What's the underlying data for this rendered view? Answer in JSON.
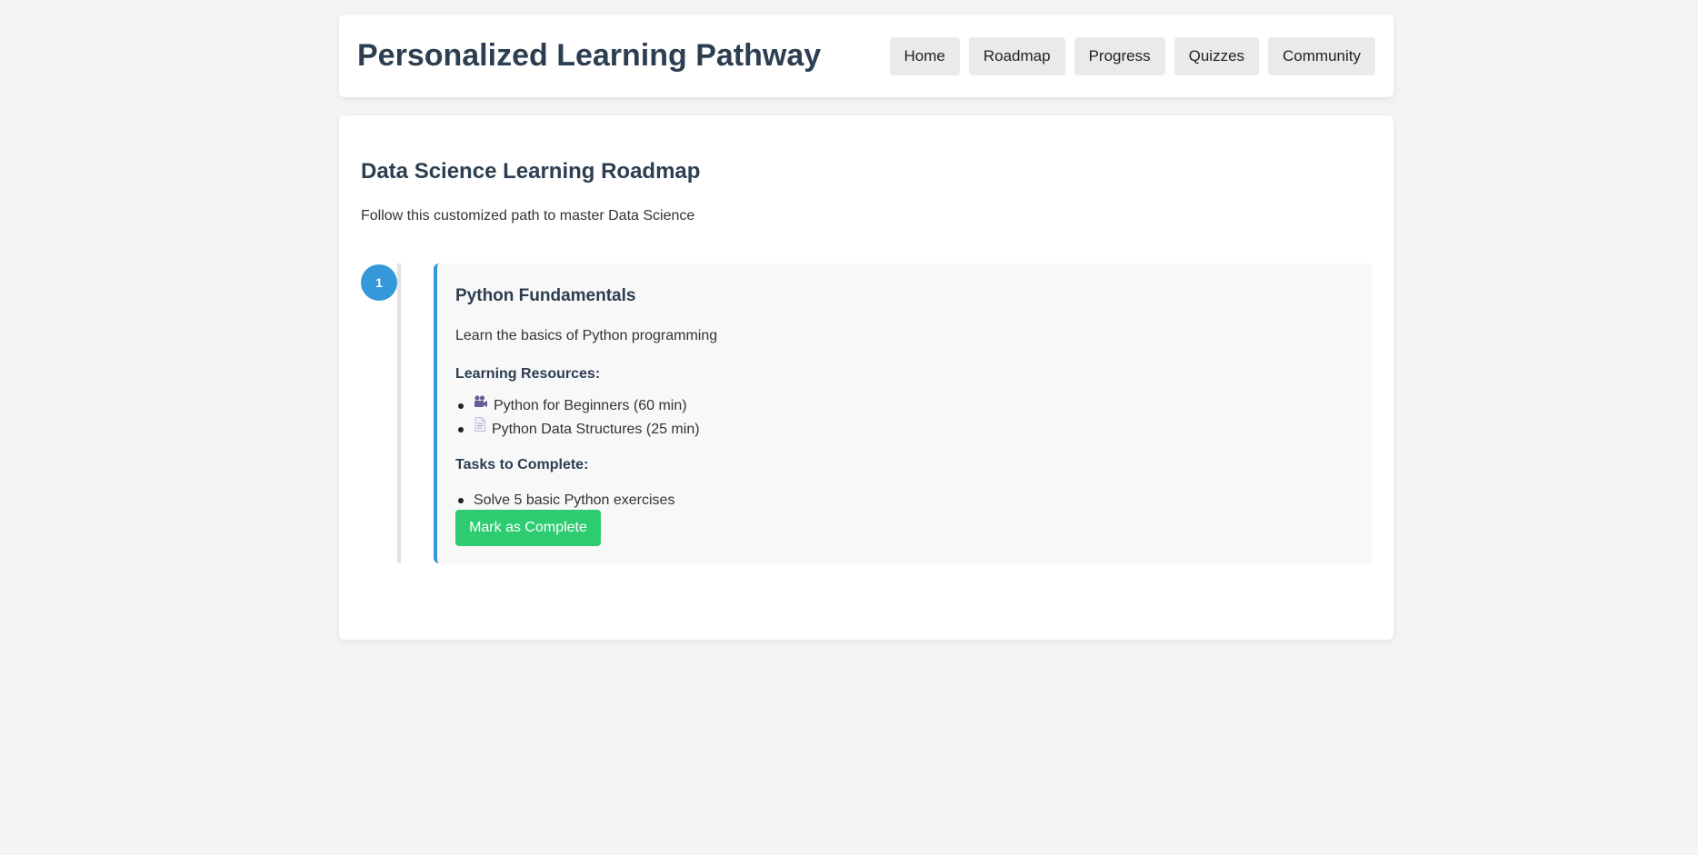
{
  "header": {
    "title": "Personalized Learning Pathway",
    "nav": [
      "Home",
      "Roadmap",
      "Progress",
      "Quizzes",
      "Community"
    ]
  },
  "main": {
    "title": "Data Science Learning Roadmap",
    "subtitle": "Follow this customized path to master Data Science",
    "steps": [
      {
        "number": "1",
        "title": "Python Fundamentals",
        "description": "Learn the basics of Python programming",
        "resources_heading": "Learning Resources:",
        "resources": [
          {
            "icon": "video-camera-icon",
            "label": "Python for Beginners (60 min)"
          },
          {
            "icon": "document-icon",
            "label": "Python Data Structures (25 min)"
          }
        ],
        "tasks_heading": "Tasks to Complete:",
        "tasks": [
          "Solve 5 basic Python exercises"
        ],
        "button_label": "Mark as Complete"
      }
    ]
  },
  "colors": {
    "accent": "#3498db",
    "success": "#2ecc71",
    "heading": "#2c3e50",
    "background": "#f4f4f4"
  }
}
